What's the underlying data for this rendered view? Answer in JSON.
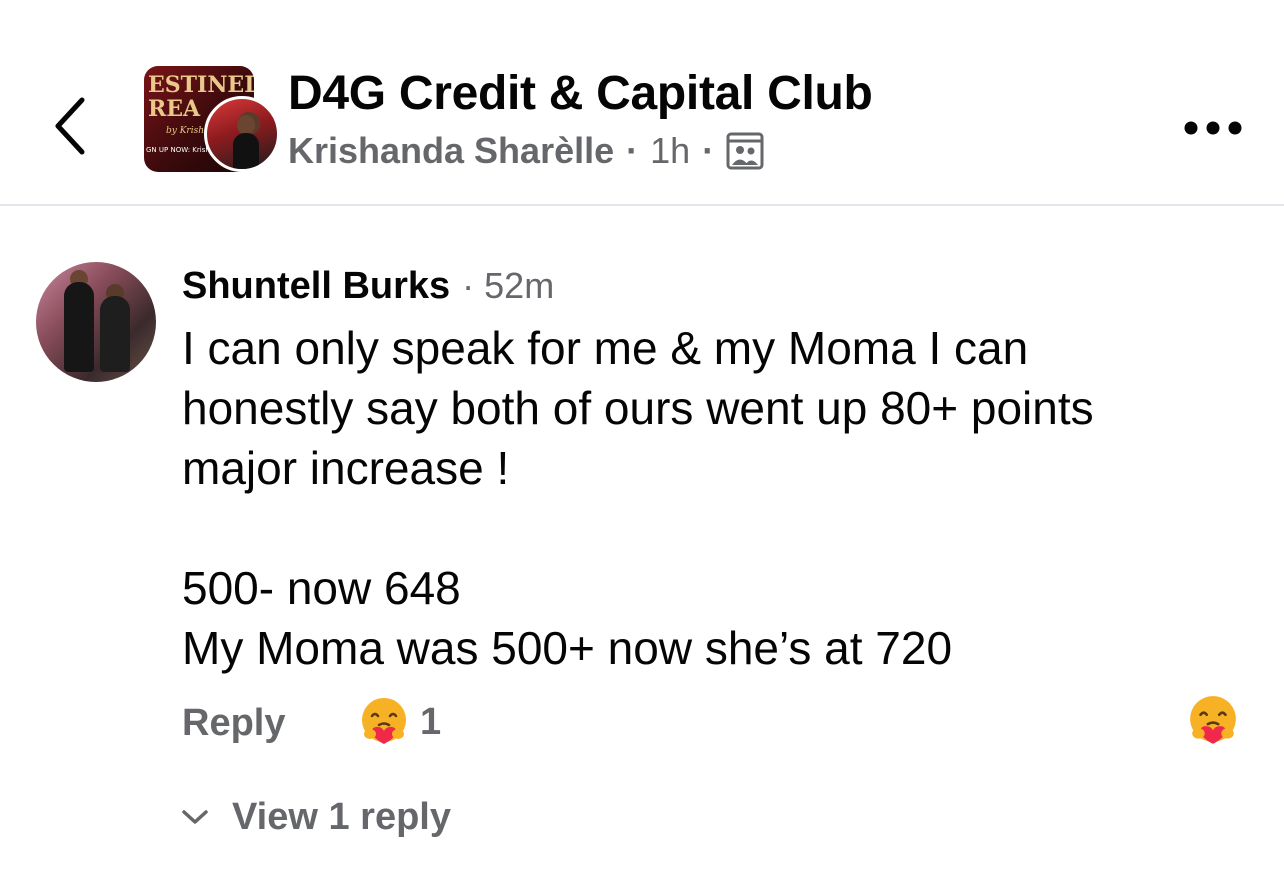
{
  "header": {
    "group_name": "D4G Credit & Capital Club",
    "author_name": "Krishanda Sharèlle",
    "post_time": "1h",
    "separator": "·",
    "audience_icon": "group-icon",
    "back_icon": "chevron-left-icon",
    "more_icon": "more-dots-icon",
    "group_cover": {
      "line1": "ESTINED",
      "line2": "REA",
      "by_text": "by Krish",
      "signup_text": "GN UP NOW: Krisha"
    }
  },
  "comment": {
    "author": "Shuntell Burks",
    "separator": "·",
    "time": "52m",
    "lines": [
      "I can only speak for me & my Moma I can",
      "honestly say both of ours went up 80+ points",
      "major increase !",
      "",
      "500- now 648",
      "My Moma was 500+ now she’s at 720"
    ],
    "reply_label": "Reply",
    "reaction_icon": "care-emoji-icon",
    "reaction_count": "1",
    "view_replies_label": "View 1 reply"
  },
  "colors": {
    "text_primary": "#050505",
    "text_secondary": "#65676b",
    "divider": "#e4e6eb",
    "care_face": "#f7b125",
    "care_heart": "#f0284a"
  }
}
